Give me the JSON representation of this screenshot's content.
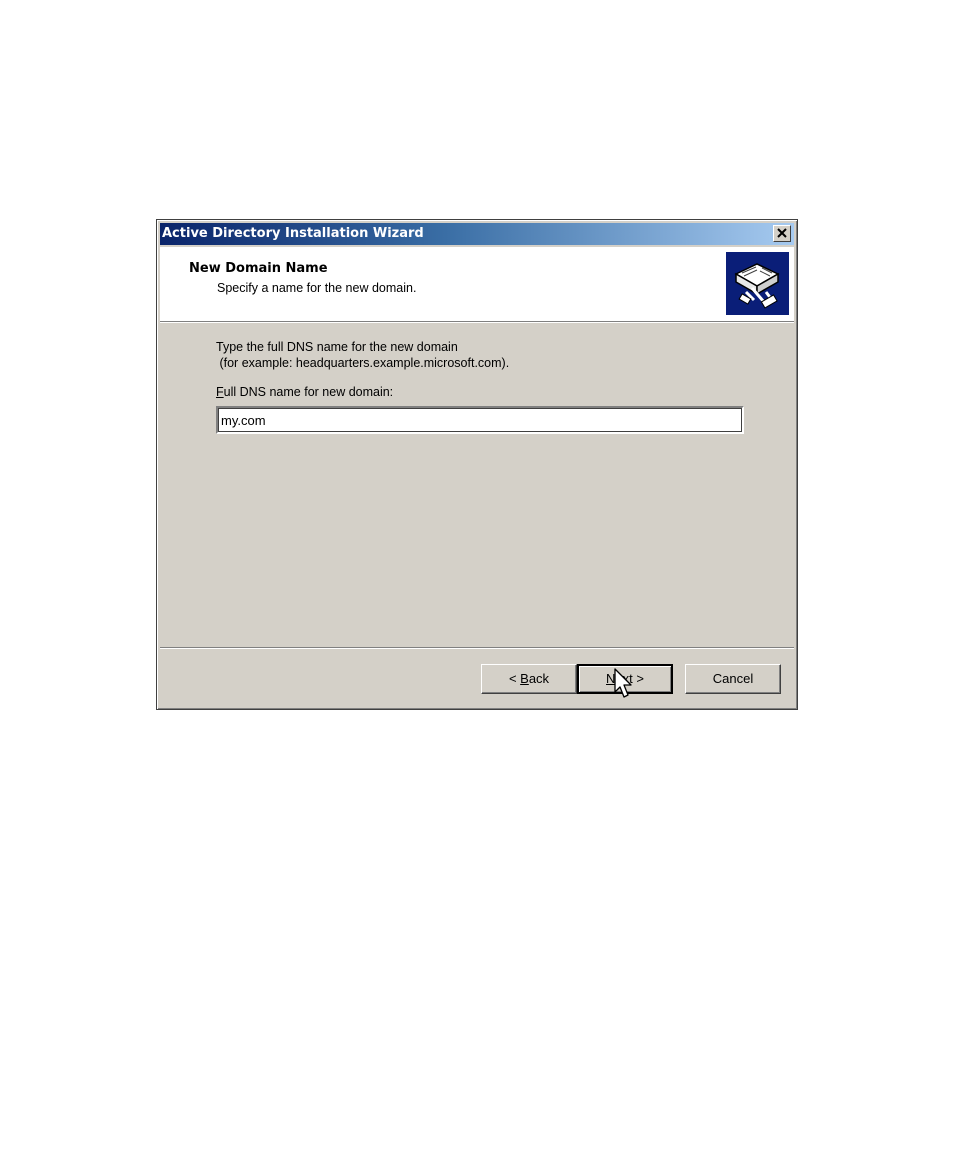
{
  "window": {
    "title": "Active Directory Installation Wizard",
    "close_symbol": "×"
  },
  "header": {
    "title": "New Domain Name",
    "subtitle": "Specify a name for the new domain.",
    "icon": "directory-book-icon"
  },
  "content": {
    "description": "Type the full DNS name for the new domain\n (for example: headquarters.example.microsoft.com).",
    "field_label_accel": "F",
    "field_label_rest": "ull DNS name for new domain:",
    "field_value": "my.com"
  },
  "buttons": {
    "back_prefix": "< ",
    "back_accel": "B",
    "back_rest": "ack",
    "next_accel": "N",
    "next_rest": "ext >",
    "cancel": "Cancel"
  },
  "colors": {
    "titlebar_start": "#0a246a",
    "titlebar_end": "#a6caf0",
    "dialog_face": "#d4d0c8",
    "icon_bg": "#0a1e78"
  }
}
